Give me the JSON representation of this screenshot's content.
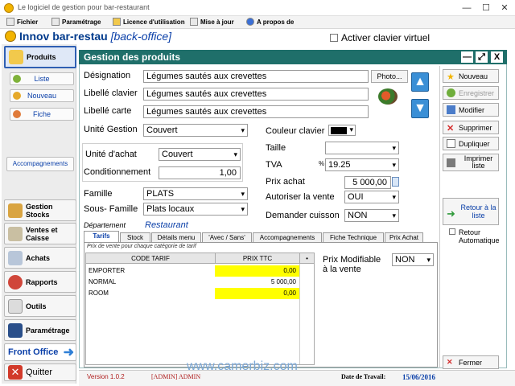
{
  "window": {
    "title": "Le logiciel de gestion pour bar-restaurant",
    "minimize": "—",
    "maximize": "☐",
    "close": "✕"
  },
  "menu": [
    {
      "label": "Fichier"
    },
    {
      "label": "Paramétrage"
    },
    {
      "label": "Licence d'utilisation"
    },
    {
      "label": "Mise à jour"
    },
    {
      "label": "A propos de"
    }
  ],
  "header": {
    "app_name": "Innov bar-restau",
    "app_sub": "[back-office]",
    "virtual_keyboard": "Activer clavier virtuel"
  },
  "nav": {
    "produits": "Produits",
    "liste": "Liste",
    "nouveau": "Nouveau",
    "fiche": "Fiche",
    "accompagnements": "Accompagnements",
    "gestion_stocks": "Gestion Stocks",
    "ventes_caisse": "Ventes et Caisse",
    "achats": "Achats",
    "rapports": "Rapports",
    "outils": "Outils",
    "parametrage": "Paramétrage",
    "front_office": "Front Office",
    "quitter": "Quitter"
  },
  "panel": {
    "title": "Gestion des produits",
    "designation_label": "Désignation",
    "designation_value": "Légumes sautés aux crevettes",
    "photo_button": "Photo...",
    "libelle_clavier_label": "Libellé clavier",
    "libelle_clavier_value": "Légumes sautés aux crevettes",
    "libelle_carte_label": "Libellé carte",
    "libelle_carte_value": "Légumes sautés aux crevettes",
    "unite_gestion_label": "Unité Gestion",
    "unite_gestion_value": "Couvert",
    "unite_achat_label": "Unité d'achat",
    "unite_achat_value": "Couvert",
    "conditionnement_label": "Conditionnement",
    "conditionnement_value": "1,00",
    "famille_label": "Famille",
    "famille_value": "PLATS",
    "sous_famille_label": "Sous- Famille",
    "sous_famille_value": "Plats locaux",
    "departement_label": "Département",
    "departement_value": "Restaurant",
    "couleur_clavier_label": "Couleur clavier",
    "taille_label": "Taille",
    "taille_value": "",
    "tva_label": "TVA",
    "tva_prefix": "%",
    "tva_value": "19.25",
    "prix_achat_label": "Prix achat",
    "prix_achat_value": "5 000,00",
    "autoriser_vente_label": "Autoriser la vente",
    "autoriser_vente_value": "OUI",
    "demander_cuisson_label": "Demander cuisson",
    "demander_cuisson_value": "NON"
  },
  "actions": {
    "nouveau": "Nouveau",
    "enregistrer": "Enregistrer",
    "modifier": "Modifier",
    "supprimer": "Supprimer",
    "dupliquer": "Dupliquer",
    "imprimer_liste": "Imprimer liste",
    "retour_liste": "Retour à la liste",
    "retour_auto": "Retour Automatique",
    "fermer": "Fermer"
  },
  "tabs": [
    "Tarifs",
    "Stock",
    "Détails menu",
    "'Avec / Sans'",
    "Accompagnements",
    "Fiche Technique",
    "Prix Achat"
  ],
  "tarifs": {
    "hint": "Prix de vente pour chaque catégorie de tarif",
    "col_code": "CODE TARIF",
    "col_prix": "PRIX TTC",
    "col_marker": "•",
    "rows": [
      {
        "code": "EMPORTER",
        "prix": "0,00"
      },
      {
        "code": "NORMAL",
        "prix": "5 000,00"
      },
      {
        "code": "ROOM",
        "prix": "0,00"
      }
    ],
    "prix_modifiable_label": "Prix Modifiable à la vente",
    "prix_modifiable_value": "NON"
  },
  "status": {
    "version": "Version 1.0.2",
    "user": "[ADMIN] ADMIN",
    "date_label": "Date de Travail:",
    "date_value": "15/06/2016"
  },
  "watermark": "www.camerbiz.com",
  "colors": {
    "panel_head": "#1f6f6a",
    "accent": "#0a3fa8",
    "price_cell": "#ffff00"
  }
}
